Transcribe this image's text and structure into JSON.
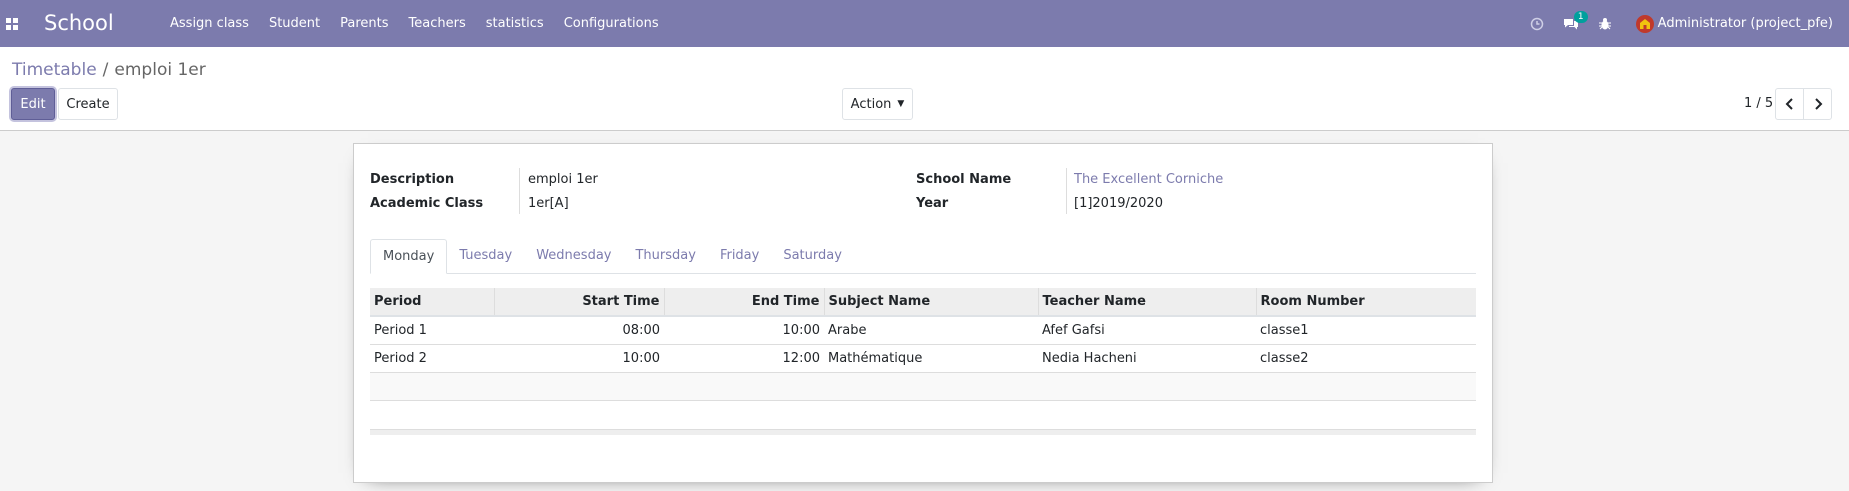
{
  "navbar": {
    "brand": "School",
    "menu": [
      "Assign class",
      "Student",
      "Parents",
      "Teachers",
      "statistics",
      "Configurations"
    ],
    "messages_badge": "1",
    "user": "Administrator (project_pfe)",
    "bg_color": "#7c7bad"
  },
  "breadcrumb": {
    "parent": "Timetable",
    "separator": "/",
    "current": "emploi 1er"
  },
  "buttons": {
    "edit": "Edit",
    "create": "Create",
    "action": "Action"
  },
  "pager": {
    "value": "1 / 5"
  },
  "form": {
    "description_label": "Description",
    "description_value": "emploi 1er",
    "class_label": "Academic Class",
    "class_value": "1er[A]",
    "school_label": "School Name",
    "school_value": "The Excellent Corniche",
    "year_label": "Year",
    "year_value": "[1]2019/2020"
  },
  "tabs": [
    "Monday",
    "Tuesday",
    "Wednesday",
    "Thursday",
    "Friday",
    "Saturday"
  ],
  "table": {
    "headers": [
      "Period",
      "Start Time",
      "End Time",
      "Subject Name",
      "Teacher Name",
      "Room Number"
    ],
    "rows": [
      [
        "Period 1",
        "08:00",
        "10:00",
        "Arabe",
        "Afef Gafsi",
        "classe1"
      ],
      [
        "Period 2",
        "10:00",
        "12:00",
        "Mathématique",
        "Nedia Hacheni",
        "classe2"
      ]
    ]
  }
}
